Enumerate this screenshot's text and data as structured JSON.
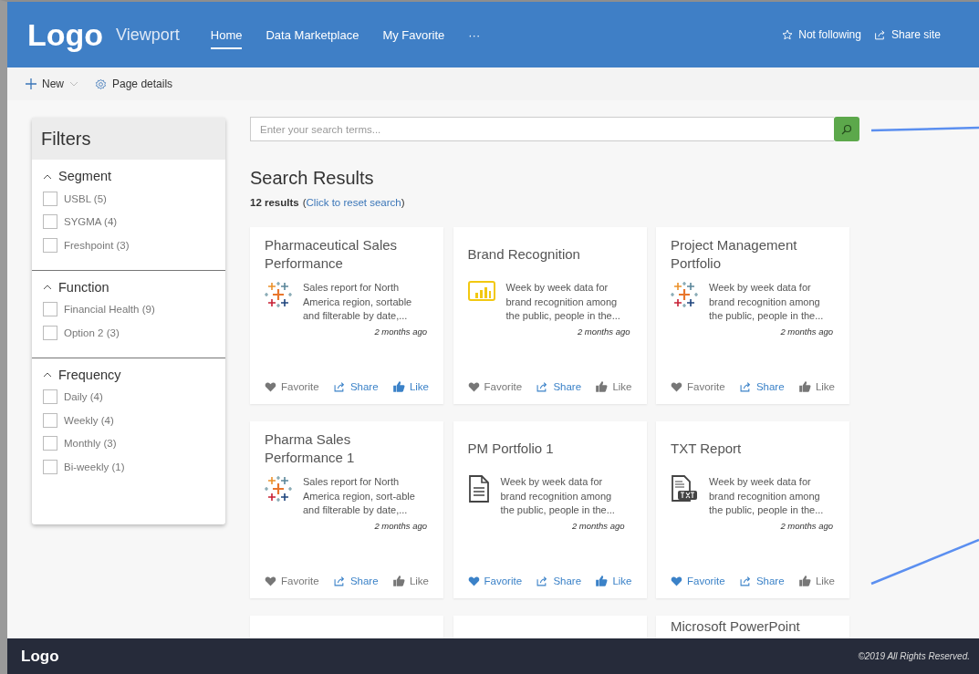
{
  "header": {
    "logo": "Logo",
    "site_name": "Viewport",
    "nav": [
      {
        "label": "Home",
        "selected": true
      },
      {
        "label": "Data Marketplace",
        "selected": false
      },
      {
        "label": "My Favorite",
        "selected": false
      },
      {
        "label": "···",
        "selected": false
      }
    ],
    "actions": [
      {
        "kind": "follow",
        "label": "Not following"
      },
      {
        "kind": "share",
        "label": "Share site"
      }
    ]
  },
  "toolbar": {
    "new_label": "New",
    "details_label": "Page details"
  },
  "filters": {
    "title": "Filters",
    "groups": [
      {
        "name": "Segment",
        "expanded": true,
        "options": [
          {
            "label": "USBL (5)",
            "checked": false
          },
          {
            "label": "SYGMA (4)",
            "checked": false
          },
          {
            "label": "Freshpoint (3)",
            "checked": false
          }
        ]
      },
      {
        "name": "Function",
        "expanded": true,
        "options": [
          {
            "label": "Financial Health (9)",
            "checked": false
          },
          {
            "label": "Option 2 (3)",
            "checked": false
          }
        ]
      },
      {
        "name": "Frequency",
        "expanded": true,
        "options": [
          {
            "label": "Daily (4)",
            "checked": false
          },
          {
            "label": "Weekly (4)",
            "checked": false
          },
          {
            "label": "Monthly (3)",
            "checked": false
          },
          {
            "label": "Bi-weekly (1)",
            "checked": false
          }
        ]
      }
    ]
  },
  "search": {
    "placeholder": "Enter your search terms..."
  },
  "results": {
    "title": "Search Results",
    "count": "12 results",
    "open_paren": "(",
    "reset_link": "Click to reset search",
    "close_paren": ")"
  },
  "cards": [
    {
      "title": "Pharmaceutical Sales Performance",
      "kind": "tableau",
      "description": "Sales report for North America region, sortable and filterable by date,...",
      "time": "2 months ago",
      "favorite": false,
      "liked": true,
      "favorite_label": "Favorite",
      "share_label": "Share",
      "like_label": "Like"
    },
    {
      "title": "Brand Recognition",
      "kind": "powerbi",
      "description": "Week by week data for brand recognition among the public, people in the...",
      "time": "2 months ago",
      "favorite": false,
      "liked": false,
      "favorite_label": "Favorite",
      "share_label": "Share",
      "like_label": "Like"
    },
    {
      "title": "Project Management Portfolio",
      "kind": "tableau",
      "description": "Week by week data for brand recognition among the public, people in the...",
      "time": "2 months ago",
      "favorite": false,
      "liked": false,
      "favorite_label": "Favorite",
      "share_label": "Share",
      "like_label": "Like"
    },
    {
      "title": "Pharma Sales Performance 1",
      "kind": "tableau",
      "description": "Sales report for North America region, sort-able and filterable by date,...",
      "time": "2 months ago",
      "favorite": false,
      "liked": false,
      "favorite_label": "Favorite",
      "share_label": "Share",
      "like_label": "Like"
    },
    {
      "title": "PM Portfolio 1",
      "kind": "document",
      "description": "Week by week data for brand recognition among the public, people in the...",
      "time": "2 months ago",
      "favorite": true,
      "liked": true,
      "favorite_label": "Favorite",
      "share_label": "Share",
      "like_label": "Like"
    },
    {
      "title": "TXT Report",
      "kind": "txt",
      "description": "Week by week data for brand recognition among the public, people in the...",
      "time": "2 months ago",
      "favorite": true,
      "liked": false,
      "favorite_label": "Favorite",
      "share_label": "Share",
      "like_label": "Like"
    }
  ],
  "partial_cards": [
    {
      "kind": "blank"
    },
    {
      "kind": "blank"
    },
    {
      "kind": "titled",
      "title": "Microsoft PowerPoint"
    }
  ],
  "footer": {
    "logo": "Logo",
    "copyright": "©2019 All Rights Reserved."
  }
}
